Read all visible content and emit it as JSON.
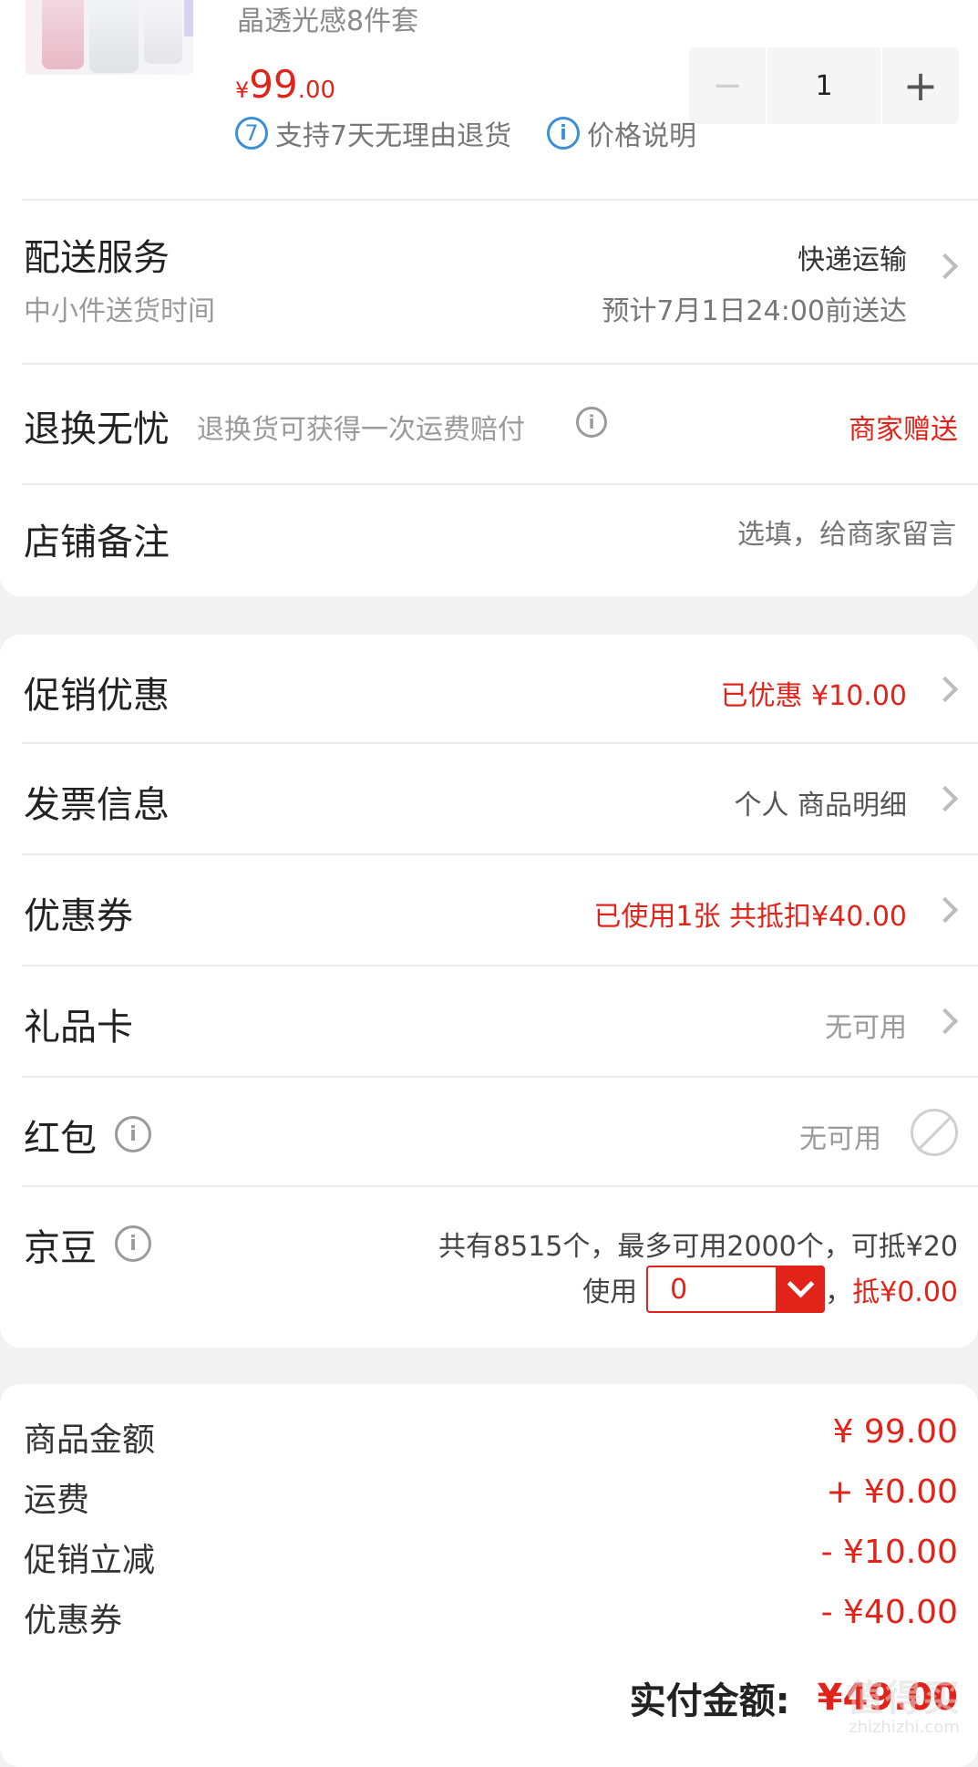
{
  "product": {
    "name": "晶透光感8件套",
    "price_currency": "¥",
    "price_int": "99",
    "price_dec": ".00",
    "quantity": "1",
    "minus": "−",
    "plus": "+",
    "badge_7_num": "7",
    "badge_7_text": "支持7天无理由退货",
    "badge_info_letter": "i",
    "badge_info_text": "价格说明"
  },
  "delivery": {
    "label": "配送服务",
    "sublabel": "中小件送货时间",
    "method": "快递运输",
    "eta": "预计7月1日24:00前送达"
  },
  "return_worry": {
    "label": "退换无忧",
    "desc": "退换货可获得一次运费赔付",
    "info_letter": "i",
    "value": "商家赠送"
  },
  "store_note": {
    "label": "店铺备注",
    "placeholder": "选填，给商家留言"
  },
  "promo": {
    "label": "促销优惠",
    "value": "已优惠 ¥10.00"
  },
  "invoice": {
    "label": "发票信息",
    "value": "个人 商品明细"
  },
  "coupon": {
    "label": "优惠券",
    "value": "已使用1张 共抵扣¥40.00"
  },
  "giftcard": {
    "label": "礼品卡",
    "value": "无可用"
  },
  "redpacket": {
    "label": "红包",
    "info_letter": "i",
    "value": "无可用"
  },
  "jingdou": {
    "label": "京豆",
    "info_letter": "i",
    "summary": "共有8515个，最多可用2000个，可抵¥20",
    "use_label": "使用",
    "use_value": "0",
    "comma": "，",
    "deduct": "抵¥0.00"
  },
  "summary": {
    "rows": [
      {
        "label": "商品金额",
        "value": "¥ 99.00"
      },
      {
        "label": "运费",
        "value": "+ ¥0.00"
      },
      {
        "label": "促销立减",
        "value": "- ¥10.00"
      },
      {
        "label": "优惠券",
        "value": "- ¥40.00"
      }
    ],
    "total_label": "实付金额:",
    "total_value": "¥49.00"
  },
  "watermark": {
    "main": "值得买",
    "sub": "zhizhizhi.com"
  },
  "colors": {
    "accent": "#e2231a",
    "info_blue": "#3b8fd9",
    "gray": "#9a9a9a",
    "bg": "#f2f2f2"
  }
}
